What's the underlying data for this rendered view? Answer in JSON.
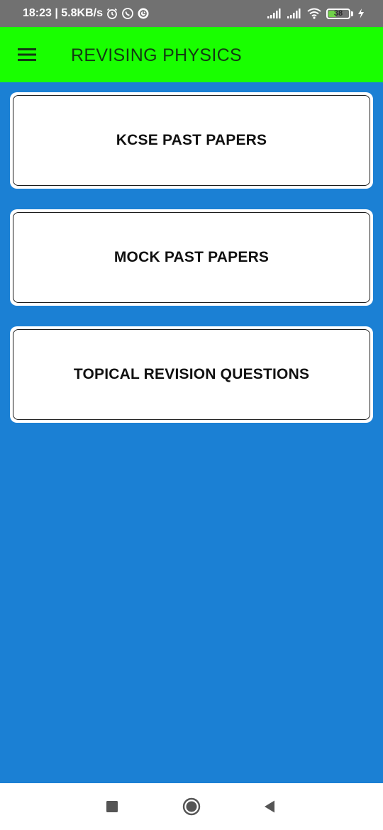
{
  "status_bar": {
    "time_speed": "18:23 | 5.8KB/s",
    "battery_level": "38",
    "icons": [
      "alarm-icon",
      "whatsapp-icon",
      "sync-icon",
      "signal-icon",
      "signal-icon",
      "wifi-icon",
      "battery-icon",
      "charging-icon"
    ]
  },
  "app_bar": {
    "title": "REVISING PHYSICS",
    "menu_icon": "hamburger-menu-icon",
    "background_color": "#19ff00"
  },
  "menu": {
    "items": [
      {
        "label": "KCSE PAST PAPERS"
      },
      {
        "label": "MOCK PAST PAPERS"
      },
      {
        "label": "TOPICAL REVISION QUESTIONS"
      }
    ]
  },
  "theme": {
    "background_color": "#1b80d4",
    "card_color": "#ffffff"
  },
  "nav_bar": {
    "buttons": [
      "recents-square-icon",
      "home-circle-icon",
      "back-triangle-icon"
    ]
  }
}
